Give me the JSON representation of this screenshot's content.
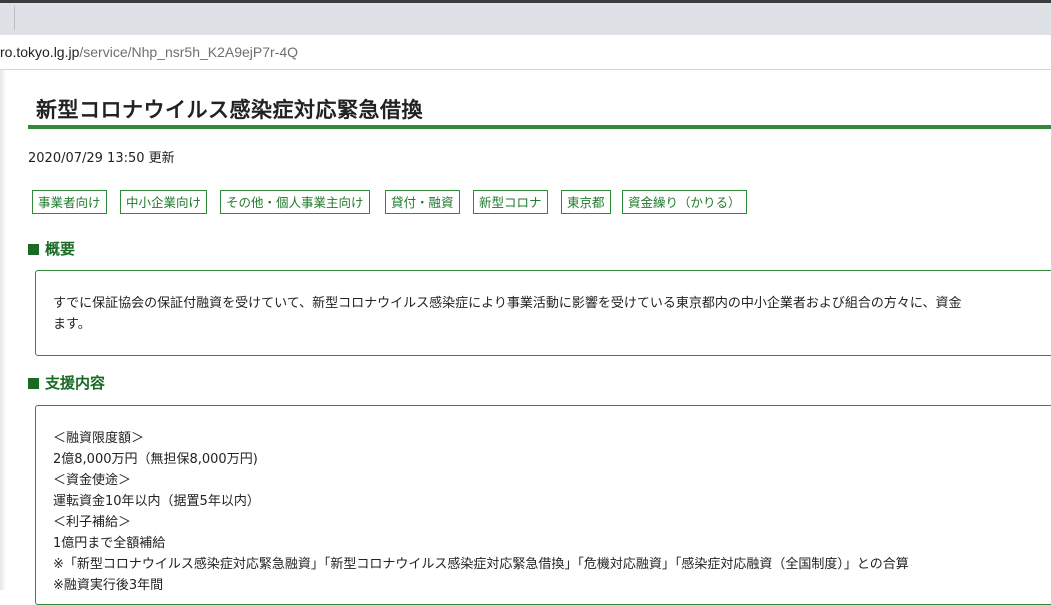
{
  "browser": {
    "url_host": "ro.tokyo.lg.jp",
    "url_path": "/service/Nhp_nsr5h_K2A9ejP7r-4Q"
  },
  "page": {
    "title": "新型コロナウイルス感染症対応緊急借換",
    "updated": "2020/07/29 13:50 更新",
    "tags": [
      "事業者向け",
      "中小企業向け",
      "その他・個人事業主向け",
      "貸付・融資",
      "新型コロナ",
      "東京都",
      "資金繰り（かりる）"
    ],
    "overview": {
      "heading": "概要",
      "lines": [
        "すでに保証協会の保証付融資を受けていて、新型コロナウイルス感染症により事業活動に影響を受けている東京都内の中小企業者および組合の方々に、資金",
        "ます。"
      ]
    },
    "support": {
      "heading": "支援内容",
      "lines": [
        "＜融資限度額＞",
        "2億8,000万円（無担保8,000万円)",
        "＜資金使途＞",
        "運転資金10年以内（据置5年以内）",
        "＜利子補給＞",
        "1億円まで全額補給",
        "※「新型コロナウイルス感染症対応緊急融資」「新型コロナウイルス感染症対応緊急借換」「危機対応融資」「感染症対応融資（全国制度）」との合算",
        "※融資実行後3年間"
      ]
    },
    "colors": {
      "accent": "#2e8b3a",
      "heading": "#1a6a26"
    }
  }
}
